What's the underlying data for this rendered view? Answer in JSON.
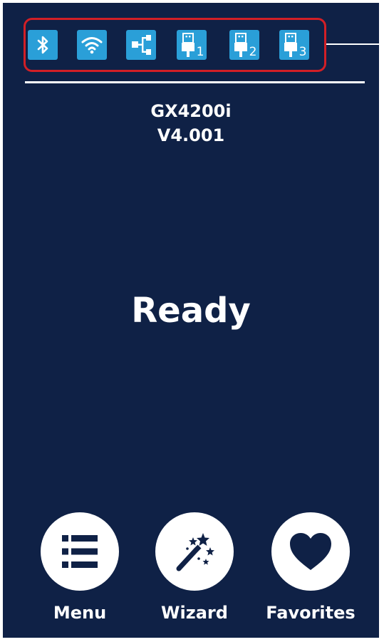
{
  "status_icons": [
    {
      "icon": "bluetooth-icon",
      "label": ""
    },
    {
      "icon": "wifi-icon",
      "label": ""
    },
    {
      "icon": "ethernet-icon",
      "label": ""
    },
    {
      "icon": "usb-icon",
      "label": "1"
    },
    {
      "icon": "usb-icon",
      "label": "2"
    },
    {
      "icon": "usb-icon",
      "label": "3"
    }
  ],
  "device": {
    "model": "GX4200i",
    "version": "V4.001"
  },
  "status": {
    "text": "Ready"
  },
  "actions": {
    "menu_label": "Menu",
    "wizard_label": "Wizard",
    "favorites_label": "Favorites"
  },
  "colors": {
    "background": "#0f2146",
    "icon_tile": "#2a9fd8",
    "highlight_frame": "#d21f26",
    "text": "#ffffff"
  }
}
